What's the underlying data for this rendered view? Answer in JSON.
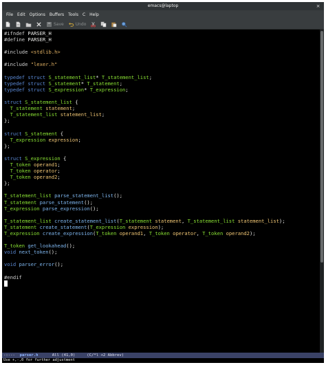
{
  "window": {
    "title": "emacs@laptop",
    "close_glyph": "×"
  },
  "menubar": {
    "items": [
      "File",
      "Edit",
      "Options",
      "Buffers",
      "Tools",
      "C",
      "Help"
    ]
  },
  "toolbar": {
    "save_label": "Save",
    "undo_label": "Undo",
    "icons": [
      "new-file-icon",
      "open-file-icon",
      "open-directory-icon",
      "close-buffer-icon",
      "save-icon",
      "undo-icon",
      "cut-icon",
      "copy-icon",
      "paste-icon",
      "search-icon"
    ]
  },
  "editor": {
    "lines": [
      [
        [
          "pp",
          "#ifndef "
        ],
        [
          "",
          "PARSER_H"
        ]
      ],
      [
        [
          "pp",
          "#define "
        ],
        [
          "",
          "PARSER_H"
        ]
      ],
      [],
      [
        [
          "pp",
          "#include "
        ],
        [
          "str",
          "<stdlib.h>"
        ]
      ],
      [],
      [
        [
          "pp",
          "#include "
        ],
        [
          "str",
          "\"lexer.h\""
        ]
      ],
      [],
      [
        [
          "kw",
          "typedef struct "
        ],
        [
          "ty",
          "S_statement_list"
        ],
        [
          "",
          "* "
        ],
        [
          "ty",
          "T_statement_list"
        ],
        [
          "",
          ";"
        ]
      ],
      [
        [
          "kw",
          "typedef struct "
        ],
        [
          "ty",
          "S_statement"
        ],
        [
          "",
          "* "
        ],
        [
          "ty",
          "T_statement"
        ],
        [
          "",
          ";"
        ]
      ],
      [
        [
          "kw",
          "typedef struct "
        ],
        [
          "ty",
          "S_expression"
        ],
        [
          "",
          "* "
        ],
        [
          "ty",
          "T_expression"
        ],
        [
          "",
          ";"
        ]
      ],
      [],
      [
        [
          "kw",
          "struct "
        ],
        [
          "ty",
          "S_statement_list"
        ],
        [
          "",
          " {"
        ]
      ],
      [
        [
          "",
          "  "
        ],
        [
          "ty",
          "T_statement"
        ],
        [
          "",
          " "
        ],
        [
          "var",
          "statement"
        ],
        [
          "",
          ";"
        ]
      ],
      [
        [
          "",
          "  "
        ],
        [
          "ty",
          "T_statement_list"
        ],
        [
          "",
          " "
        ],
        [
          "var",
          "statement_list"
        ],
        [
          "",
          ";"
        ]
      ],
      [
        [
          "",
          "};"
        ]
      ],
      [],
      [
        [
          "kw",
          "struct "
        ],
        [
          "ty",
          "S_statement"
        ],
        [
          "",
          " {"
        ]
      ],
      [
        [
          "",
          "  "
        ],
        [
          "ty",
          "T_expression"
        ],
        [
          "",
          " "
        ],
        [
          "var",
          "expression"
        ],
        [
          "",
          ";"
        ]
      ],
      [
        [
          "",
          "};"
        ]
      ],
      [],
      [
        [
          "kw",
          "struct "
        ],
        [
          "ty",
          "S_expression"
        ],
        [
          "",
          " {"
        ]
      ],
      [
        [
          "",
          "  "
        ],
        [
          "ty",
          "T_token"
        ],
        [
          "",
          " "
        ],
        [
          "var",
          "operand1"
        ],
        [
          "",
          ";"
        ]
      ],
      [
        [
          "",
          "  "
        ],
        [
          "ty",
          "T_token"
        ],
        [
          "",
          " "
        ],
        [
          "var",
          "operator"
        ],
        [
          "",
          ";"
        ]
      ],
      [
        [
          "",
          "  "
        ],
        [
          "ty",
          "T_token"
        ],
        [
          "",
          " "
        ],
        [
          "var",
          "operand2"
        ],
        [
          "",
          ";"
        ]
      ],
      [
        [
          "",
          "};"
        ]
      ],
      [],
      [
        [
          "ty",
          "T_statement_list"
        ],
        [
          "",
          " "
        ],
        [
          "fn",
          "parse_statement_list"
        ],
        [
          "",
          "();"
        ]
      ],
      [
        [
          "ty",
          "T_statement"
        ],
        [
          "",
          " "
        ],
        [
          "fn",
          "parse_statement"
        ],
        [
          "",
          "();"
        ]
      ],
      [
        [
          "ty",
          "T_expression"
        ],
        [
          "",
          " "
        ],
        [
          "fn",
          "parse_expression"
        ],
        [
          "",
          "();"
        ]
      ],
      [],
      [
        [
          "ty",
          "T_statement_list"
        ],
        [
          "",
          " "
        ],
        [
          "fn",
          "create_statement_list"
        ],
        [
          "",
          "("
        ],
        [
          "ty",
          "T_statement"
        ],
        [
          "",
          " "
        ],
        [
          "var",
          "statement"
        ],
        [
          "",
          ", "
        ],
        [
          "ty",
          "T_statement_list"
        ],
        [
          "",
          " "
        ],
        [
          "var",
          "statement_list"
        ],
        [
          "",
          ");"
        ]
      ],
      [
        [
          "ty",
          "T_statement"
        ],
        [
          "",
          " "
        ],
        [
          "fn",
          "create_statement"
        ],
        [
          "",
          "("
        ],
        [
          "ty",
          "T_expression"
        ],
        [
          "",
          " "
        ],
        [
          "var",
          "expression"
        ],
        [
          "",
          ");"
        ]
      ],
      [
        [
          "ty",
          "T_expression"
        ],
        [
          "",
          " "
        ],
        [
          "fn",
          "create_expression"
        ],
        [
          "",
          "("
        ],
        [
          "ty",
          "T_token"
        ],
        [
          "",
          " "
        ],
        [
          "var",
          "operand1"
        ],
        [
          "",
          ", "
        ],
        [
          "ty",
          "T_token"
        ],
        [
          "",
          " "
        ],
        [
          "var",
          "operator"
        ],
        [
          "",
          ", "
        ],
        [
          "ty",
          "T_token"
        ],
        [
          "",
          " "
        ],
        [
          "var",
          "operand2"
        ],
        [
          "",
          ");"
        ]
      ],
      [],
      [
        [
          "ty",
          "T_token"
        ],
        [
          "",
          " "
        ],
        [
          "fn",
          "get_lookahead"
        ],
        [
          "",
          "();"
        ]
      ],
      [
        [
          "kw",
          "void "
        ],
        [
          "fn",
          "next_token"
        ],
        [
          "",
          "();"
        ]
      ],
      [],
      [
        [
          "kw",
          "void "
        ],
        [
          "fn",
          "parser_error"
        ],
        [
          "",
          "();"
        ]
      ],
      [],
      [
        [
          "pp",
          "#endif"
        ]
      ]
    ]
  },
  "modeline": {
    "prefix": "-:---  ",
    "buffer_name": "parser.h",
    "position": "      All (41,0)     ",
    "modes": "(C/*l +2 Abbrev)"
  },
  "echo_area": {
    "message": "Use +,-,0 for further adjustment"
  },
  "colors": {
    "editor_bg": "#000000",
    "keyword": "#5b8ad6",
    "type": "#8ae234",
    "function": "#7fb7f0",
    "variable": "#f0c674",
    "string": "#e5b566",
    "modeline_bg": "#3a4266"
  }
}
